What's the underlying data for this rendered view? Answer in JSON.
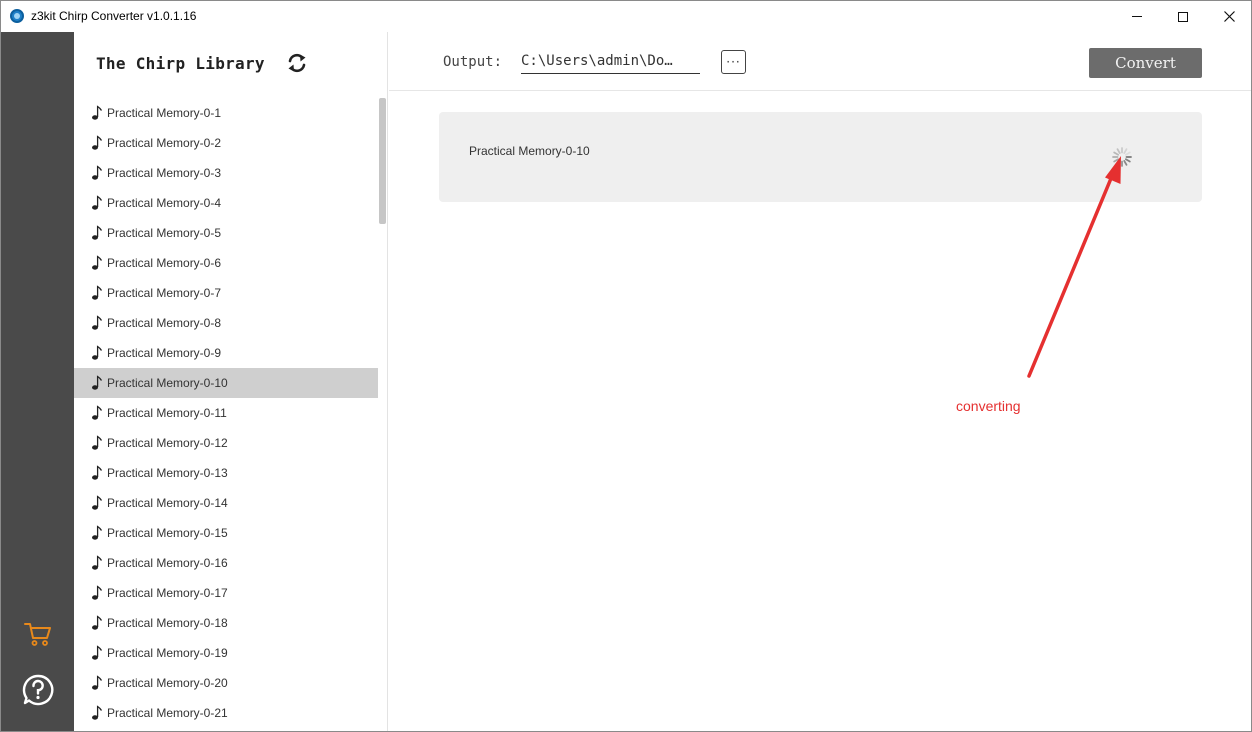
{
  "window": {
    "title": "z3kit Chirp Converter v1.0.1.16",
    "controls": {
      "minimize": "—",
      "maximize": "☐",
      "close": "✕"
    }
  },
  "rail": {
    "icons": [
      "cart-icon",
      "help-icon"
    ],
    "cart_color": "#e8891b"
  },
  "library": {
    "title": "The Chirp Library",
    "items": [
      {
        "label": "Practical Memory-0-1"
      },
      {
        "label": "Practical Memory-0-2"
      },
      {
        "label": "Practical Memory-0-3"
      },
      {
        "label": "Practical Memory-0-4"
      },
      {
        "label": "Practical Memory-0-5"
      },
      {
        "label": "Practical Memory-0-6"
      },
      {
        "label": "Practical Memory-0-7"
      },
      {
        "label": "Practical Memory-0-8"
      },
      {
        "label": "Practical Memory-0-9"
      },
      {
        "label": "Practical Memory-0-10"
      },
      {
        "label": "Practical Memory-0-11"
      },
      {
        "label": "Practical Memory-0-12"
      },
      {
        "label": "Practical Memory-0-13"
      },
      {
        "label": "Practical Memory-0-14"
      },
      {
        "label": "Practical Memory-0-15"
      },
      {
        "label": "Practical Memory-0-16"
      },
      {
        "label": "Practical Memory-0-17"
      },
      {
        "label": "Practical Memory-0-18"
      },
      {
        "label": "Practical Memory-0-19"
      },
      {
        "label": "Practical Memory-0-20"
      },
      {
        "label": "Practical Memory-0-21"
      }
    ],
    "selected_index": 9
  },
  "toolbar": {
    "output_label": "Output:",
    "output_path": "C:\\Users\\admin\\Do…",
    "browse_label": "···",
    "convert_label": "Convert"
  },
  "task": {
    "name": "Practical Memory-0-10",
    "status_icon": "spinner-icon"
  },
  "annotation": {
    "text": "converting",
    "color": "#e53030"
  }
}
